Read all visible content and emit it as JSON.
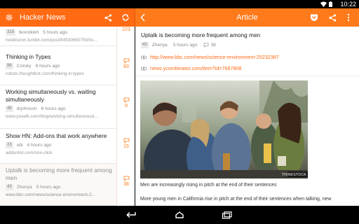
{
  "status": {
    "time": "10:22"
  },
  "app": {
    "title": "Hacker News",
    "article_header": "Article"
  },
  "stories": [
    {
      "title": "",
      "points": "315",
      "user": "tkorotkikh",
      "age": "5 hours ago",
      "url": "heidirozon.tumblr.com/post/84530650750/its...",
      "comments": "223",
      "partial": true
    },
    {
      "title": "Thinking in Types",
      "points": "96",
      "user": "Crooky",
      "age": "8 hours ago",
      "url": "robots.thoughtbot.com/thinking-in-types",
      "comments": "83"
    },
    {
      "title": "Working simultaneously vs. waiting simultaneously",
      "points": "45",
      "user": "drjohnson",
      "age": "6 hours ago",
      "url": "www.yosefk.com/blog/working-simultaneousl...",
      "comments": "9"
    },
    {
      "title": "Show HN: Add-ons that work anywhere",
      "points": "23",
      "user": "ubi",
      "age": "4 hours ago",
      "url": "addonlist.com/one-click",
      "comments": "15"
    },
    {
      "title": "Uptalk is becoming more frequent among men",
      "points": "43",
      "user": "Zhenya",
      "age": "5 hours ago",
      "url": "www.bbc.com/news/science-environment-2...",
      "comments": "38",
      "active": true
    }
  ],
  "article": {
    "title": "Uptalk is becoming more frequent among men",
    "points": "43",
    "user": "Zhenya",
    "age": "5 hours ago",
    "comments": "38",
    "link": "http://www.bbc.com/news/science-environment-25232387",
    "hn_link": "news.ycombinator.com/item?id=7687808",
    "image_watermark": "THINKSTOCK",
    "caption": "Men are increasingly rising in pitch at the end of their sentences",
    "body": "More young men in California rise in pitch at the end of their sentences when talking, new"
  },
  "colors": {
    "accent": "#ff6a13",
    "bar_right": "#ff7a1a"
  },
  "icons": {
    "settings": "gear-icon",
    "share": "share-icon",
    "refresh": "refresh-icon",
    "back": "chevron-left-icon",
    "pocket": "pocket-icon",
    "more": "more-vert-icon"
  }
}
